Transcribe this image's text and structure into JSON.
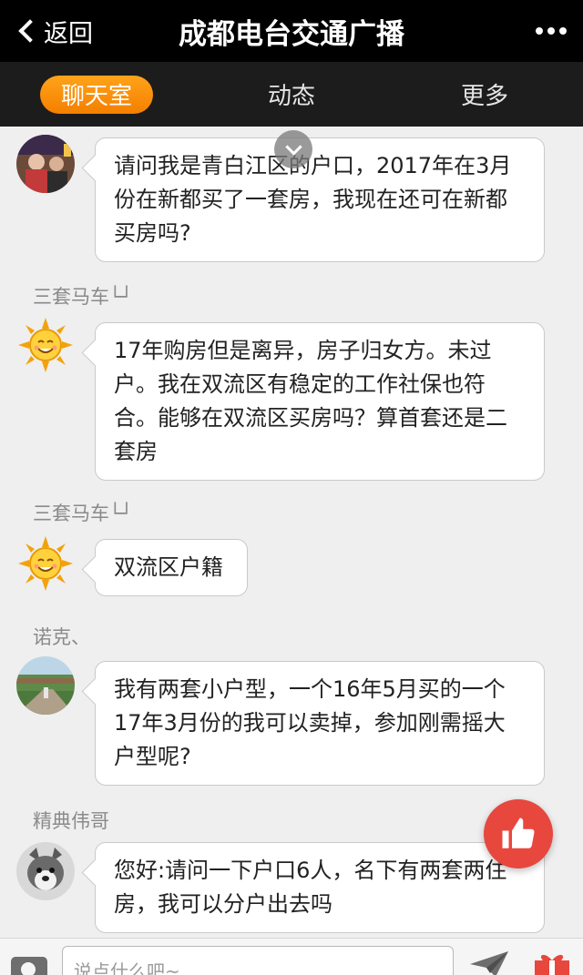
{
  "header": {
    "back_label": "返回",
    "title": "成都电台交通广播"
  },
  "tabs": [
    {
      "label": "聊天室",
      "active": true
    },
    {
      "label": "动态"
    },
    {
      "label": "更多"
    }
  ],
  "messages": [
    {
      "sender": "",
      "avatar": "photo-avatar",
      "text": "请问我是青白江区的户口，2017年在3月份在新都买了一套房，我现在还可在新都买房吗?"
    },
    {
      "sender": "三套马车└┘",
      "avatar": "sun-avatar",
      "text": "17年购房但是离异，房子归女方。未过户。我在双流区有稳定的工作社保也符合。能够在双流区买房吗？算首套还是二套房"
    },
    {
      "sender": "三套马车└┘",
      "avatar": "sun-avatar",
      "text": "双流区户籍"
    },
    {
      "sender": "诺克、",
      "avatar": "landscape-avatar",
      "text": "我有两套小户型，一个16年5月买的一个17年3月份的我可以卖掉，参加刚需摇大户型呢?"
    },
    {
      "sender": "精典伟哥",
      "avatar": "dog-avatar",
      "text": "您好:请问一下户口6人，名下有两套两住房，我可以分户出去吗"
    }
  ],
  "input": {
    "placeholder": "说点什么吧~"
  },
  "colors": {
    "header_bg": "#000000",
    "tabbar_bg": "#1c1c1c",
    "active_tab": "#f58a00",
    "like_button": "#e8473e"
  }
}
